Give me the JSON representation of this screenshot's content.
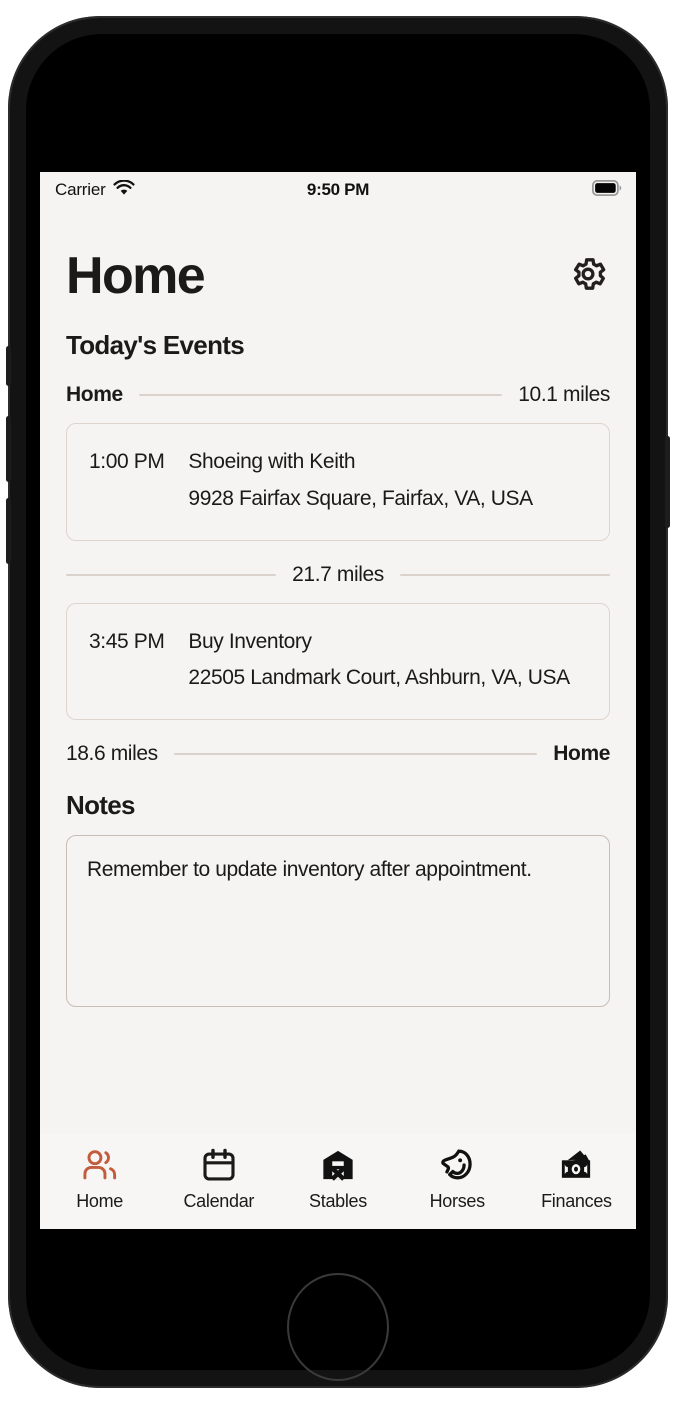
{
  "status_bar": {
    "carrier": "Carrier",
    "wifi_icon": "wifi-icon",
    "time": "9:50 PM",
    "battery_icon": "battery-full-icon"
  },
  "header": {
    "title": "Home",
    "settings_icon": "gear-icon"
  },
  "main": {
    "events_heading": "Today's Events",
    "notes_heading": "Notes",
    "start_separator": {
      "left_label": "Home",
      "right_label": "10.1 miles"
    },
    "middle_separator": {
      "center_label": "21.7 miles"
    },
    "end_separator": {
      "left_label": "18.6 miles",
      "right_label": "Home"
    },
    "events": [
      {
        "time": "1:00 PM",
        "title": "Shoeing with Keith",
        "address": "9928 Fairfax Square, Fairfax, VA, USA"
      },
      {
        "time": "3:45 PM",
        "title": "Buy Inventory",
        "address": "22505 Landmark Court, Ashburn, VA, USA"
      }
    ],
    "notes": {
      "value": "Remember to update inventory after appointment.",
      "placeholder": "Notes"
    }
  },
  "tab_bar": {
    "items": [
      {
        "label": "Home",
        "icon": "people-icon",
        "active": true
      },
      {
        "label": "Calendar",
        "icon": "calendar-icon",
        "active": false
      },
      {
        "label": "Stables",
        "icon": "barn-icon",
        "active": false
      },
      {
        "label": "Horses",
        "icon": "horse-icon",
        "active": false
      },
      {
        "label": "Finances",
        "icon": "money-icon",
        "active": false
      }
    ]
  },
  "colors": {
    "accent": "#C25C3C",
    "text": "#1c1a19",
    "background": "#F5F4F2",
    "rule": "#DCD2CC",
    "card_border": "#DDD4CE",
    "notes_border": "#C9BDB4"
  }
}
